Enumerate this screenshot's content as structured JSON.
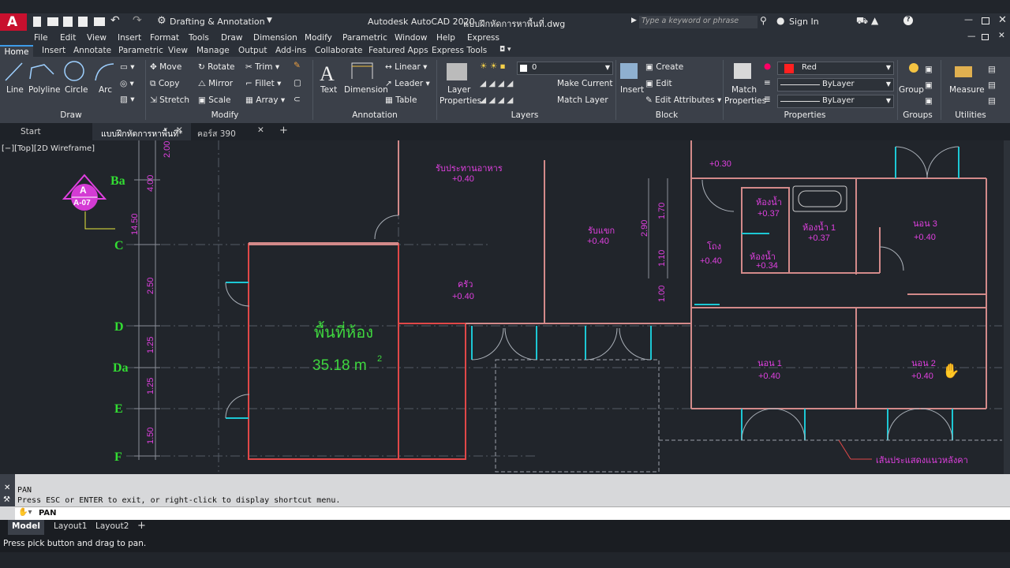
{
  "app": {
    "logo": "A",
    "title": "Autodesk AutoCAD 2020",
    "filename": "แบบฝึกหัดการหาพื้นที่.dwg",
    "workspace": "Drafting & Annotation",
    "search_placeholder": "Type a keyword or phrase",
    "sign_in": "Sign In",
    "help": "?"
  },
  "menu": [
    "File",
    "Edit",
    "View",
    "Insert",
    "Format",
    "Tools",
    "Draw",
    "Dimension",
    "Modify",
    "Parametric",
    "Window",
    "Help",
    "Express"
  ],
  "ribbon_tabs": [
    "Home",
    "Insert",
    "Annotate",
    "Parametric",
    "View",
    "Manage",
    "Output",
    "Add-ins",
    "Collaborate",
    "Featured Apps",
    "Express Tools"
  ],
  "ribbon": {
    "draw": {
      "line": "Line",
      "polyline": "Polyline",
      "circle": "Circle",
      "arc": "Arc",
      "panel": "Draw"
    },
    "modify": {
      "move": "Move",
      "rotate": "Rotate",
      "trim": "Trim",
      "copy": "Copy",
      "mirror": "Mirror",
      "fillet": "Fillet",
      "stretch": "Stretch",
      "scale": "Scale",
      "array": "Array",
      "panel": "Modify"
    },
    "annotation": {
      "text": "Text",
      "dimension": "Dimension",
      "linear": "Linear",
      "leader": "Leader",
      "table": "Table",
      "panel": "Annotation"
    },
    "layers": {
      "layer_properties": [
        "Layer",
        "Properties"
      ],
      "current_layer": "0",
      "make_current": "Make Current",
      "match_layer": "Match Layer",
      "panel": "Layers"
    },
    "block": {
      "insert": "Insert",
      "create": "Create",
      "edit": "Edit",
      "edit_attributes": "Edit Attributes",
      "panel": "Block"
    },
    "properties": {
      "match": [
        "Match",
        "Properties"
      ],
      "color": "Red",
      "linetype": "ByLayer",
      "lineweight": "ByLayer",
      "panel": "Properties"
    },
    "groups": {
      "group": "Group",
      "panel": "Groups"
    },
    "utilities": {
      "measure": "Measure",
      "panel": "Utilities"
    }
  },
  "file_tabs": [
    "Start",
    "แบบฝึกหัดการหาพื้นที่*",
    "คอร์ส 390"
  ],
  "viewport_label": "[−][Top][2D Wireframe]",
  "drawing": {
    "grid_labels": [
      "Ba",
      "C",
      "D",
      "Da",
      "E",
      "F"
    ],
    "section": {
      "letter": "A",
      "sheet": "A-07"
    },
    "dims": [
      "2.00",
      "4.00",
      "14.50",
      "2.50",
      "1.25",
      "1.25",
      "1.50",
      "2.90",
      "1.70",
      "1.10",
      "1.00"
    ],
    "area_label": "พื้นที่ห้อง",
    "area_value": "35.18 m",
    "area_sup": "2",
    "rooms": [
      {
        "name": "รับประทานอาหาร",
        "level": "+0.40"
      },
      {
        "name": "รับแขก",
        "level": "+0.40"
      },
      {
        "name": "ครัว",
        "level": "+0.40"
      },
      {
        "name": "โถง",
        "level": "+0.40"
      },
      {
        "name": "ห้องน้ำ",
        "level": "+0.37"
      },
      {
        "name": "ห้องน้ำ 1",
        "level": "+0.37"
      },
      {
        "name": "ห้องน้ำ",
        "level": "+0.34"
      },
      {
        "name": "นอน 3",
        "level": "+0.40"
      },
      {
        "name": "นอน 1",
        "level": "+0.40"
      },
      {
        "name": "นอน 2",
        "level": "+0.40"
      }
    ],
    "level_top": "+0.30",
    "eave_note": "เส้นประแสดงแนวหลังคา"
  },
  "command": {
    "history_1": "PAN",
    "history_2": "Press ESC or ENTER to exit, or right-click to display shortcut menu.",
    "input": "PAN"
  },
  "layout_tabs": [
    "Model",
    "Layout1",
    "Layout2"
  ],
  "status": "Press pick button and drag to pan.",
  "colors": {
    "wall": "#d38a8a",
    "magenta": "#e040e0",
    "green": "#33dd33",
    "cyan": "#1cc7d4",
    "accent": "#3d9be9",
    "red": "#ff2020"
  }
}
